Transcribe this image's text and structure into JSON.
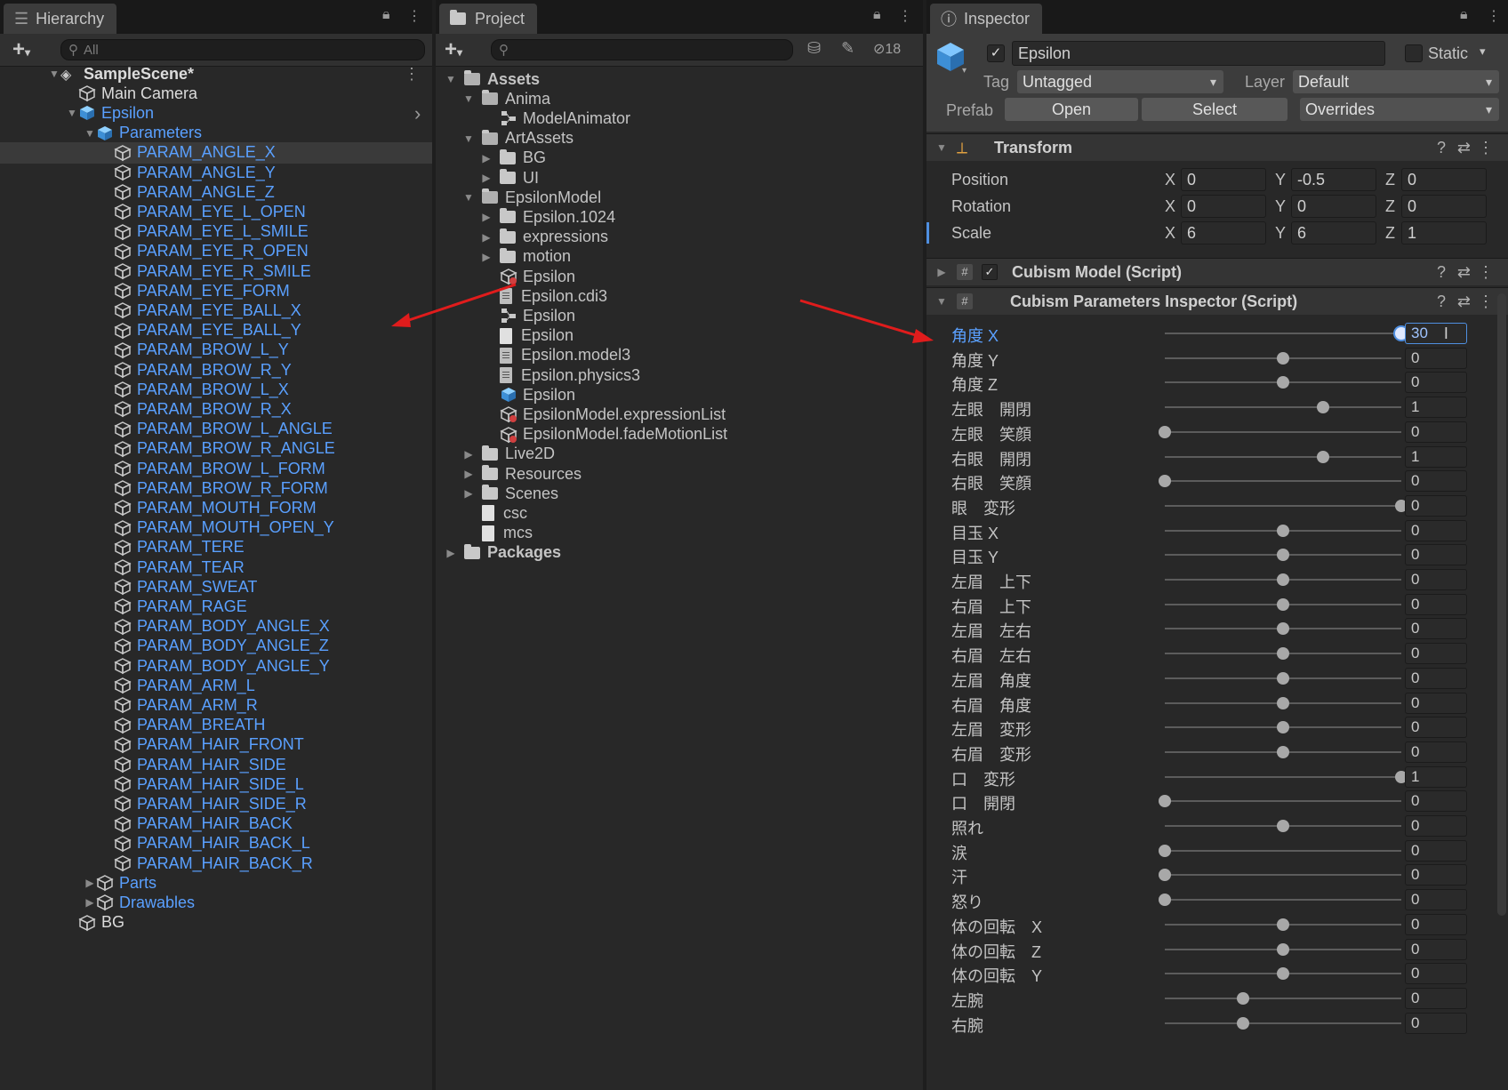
{
  "hierarchy": {
    "tab_label": "Hierarchy",
    "search_placeholder": "All",
    "scene": "SampleScene*",
    "items": [
      {
        "label": "Main Camera",
        "depth": 1,
        "blue": false
      },
      {
        "label": "Epsilon",
        "depth": 1,
        "blue": true,
        "expanded": true
      },
      {
        "label": "Parameters",
        "depth": 2,
        "blue": true,
        "expanded": true
      }
    ],
    "parameters": [
      "PARAM_ANGLE_X",
      "PARAM_ANGLE_Y",
      "PARAM_ANGLE_Z",
      "PARAM_EYE_L_OPEN",
      "PARAM_EYE_L_SMILE",
      "PARAM_EYE_R_OPEN",
      "PARAM_EYE_R_SMILE",
      "PARAM_EYE_FORM",
      "PARAM_EYE_BALL_X",
      "PARAM_EYE_BALL_Y",
      "PARAM_BROW_L_Y",
      "PARAM_BROW_R_Y",
      "PARAM_BROW_L_X",
      "PARAM_BROW_R_X",
      "PARAM_BROW_L_ANGLE",
      "PARAM_BROW_R_ANGLE",
      "PARAM_BROW_L_FORM",
      "PARAM_BROW_R_FORM",
      "PARAM_MOUTH_FORM",
      "PARAM_MOUTH_OPEN_Y",
      "PARAM_TERE",
      "PARAM_TEAR",
      "PARAM_SWEAT",
      "PARAM_RAGE",
      "PARAM_BODY_ANGLE_X",
      "PARAM_BODY_ANGLE_Z",
      "PARAM_BODY_ANGLE_Y",
      "PARAM_ARM_L",
      "PARAM_ARM_R",
      "PARAM_BREATH",
      "PARAM_HAIR_FRONT",
      "PARAM_HAIR_SIDE",
      "PARAM_HAIR_SIDE_L",
      "PARAM_HAIR_SIDE_R",
      "PARAM_HAIR_BACK",
      "PARAM_HAIR_BACK_L",
      "PARAM_HAIR_BACK_R"
    ],
    "after": [
      {
        "label": "Parts",
        "depth": 2,
        "blue": true
      },
      {
        "label": "Drawables",
        "depth": 2,
        "blue": true
      },
      {
        "label": "BG",
        "depth": 1,
        "blue": false
      }
    ]
  },
  "project": {
    "tab_label": "Project",
    "hidden_count": "18",
    "tree": [
      {
        "label": "Assets",
        "depth": 0,
        "icon": "folder-open",
        "arrow": "down",
        "bold": true
      },
      {
        "label": "Anima",
        "depth": 1,
        "icon": "folder-open",
        "arrow": "down"
      },
      {
        "label": "ModelAnimator",
        "depth": 2,
        "icon": "animator",
        "arrow": ""
      },
      {
        "label": "ArtAssets",
        "depth": 1,
        "icon": "folder-open",
        "arrow": "down"
      },
      {
        "label": "BG",
        "depth": 2,
        "icon": "folder",
        "arrow": "right"
      },
      {
        "label": "UI",
        "depth": 2,
        "icon": "folder",
        "arrow": "right"
      },
      {
        "label": "EpsilonModel",
        "depth": 1,
        "icon": "folder-open",
        "arrow": "down"
      },
      {
        "label": "Epsilon.1024",
        "depth": 2,
        "icon": "folder",
        "arrow": "right"
      },
      {
        "label": "expressions",
        "depth": 2,
        "icon": "folder",
        "arrow": "right"
      },
      {
        "label": "motion",
        "depth": 2,
        "icon": "folder",
        "arrow": "right"
      },
      {
        "label": "Epsilon",
        "depth": 2,
        "icon": "asset",
        "arrow": ""
      },
      {
        "label": "Epsilon.cdi3",
        "depth": 2,
        "icon": "doc",
        "arrow": ""
      },
      {
        "label": "Epsilon",
        "depth": 2,
        "icon": "animator",
        "arrow": ""
      },
      {
        "label": "Epsilon",
        "depth": 2,
        "icon": "file",
        "arrow": ""
      },
      {
        "label": "Epsilon.model3",
        "depth": 2,
        "icon": "doc",
        "arrow": ""
      },
      {
        "label": "Epsilon.physics3",
        "depth": 2,
        "icon": "doc",
        "arrow": ""
      },
      {
        "label": "Epsilon",
        "depth": 2,
        "icon": "prefab",
        "arrow": ""
      },
      {
        "label": "EpsilonModel.expressionList",
        "depth": 2,
        "icon": "asset",
        "arrow": ""
      },
      {
        "label": "EpsilonModel.fadeMotionList",
        "depth": 2,
        "icon": "asset",
        "arrow": ""
      },
      {
        "label": "Live2D",
        "depth": 1,
        "icon": "folder",
        "arrow": "right"
      },
      {
        "label": "Resources",
        "depth": 1,
        "icon": "folder",
        "arrow": "right"
      },
      {
        "label": "Scenes",
        "depth": 1,
        "icon": "folder",
        "arrow": "right"
      },
      {
        "label": "csc",
        "depth": 1,
        "icon": "file",
        "arrow": ""
      },
      {
        "label": "mcs",
        "depth": 1,
        "icon": "file",
        "arrow": ""
      },
      {
        "label": "Packages",
        "depth": 0,
        "icon": "folder",
        "arrow": "right",
        "bold": true
      }
    ]
  },
  "inspector": {
    "tab_label": "Inspector",
    "object_name": "Epsilon",
    "static_label": "Static",
    "tag_label": "Tag",
    "tag_value": "Untagged",
    "layer_label": "Layer",
    "layer_value": "Default",
    "prefab_label": "Prefab",
    "open_label": "Open",
    "select_label": "Select",
    "overrides_label": "Overrides",
    "transform": {
      "title": "Transform",
      "position_label": "Position",
      "px": "0",
      "py": "-0.5",
      "pz": "0",
      "rotation_label": "Rotation",
      "rx": "0",
      "ry": "0",
      "rz": "0",
      "scale_label": "Scale",
      "sx": "6",
      "sy": "6",
      "sz": "1"
    },
    "cubism_model": "Cubism Model (Script)",
    "cubism_params": "Cubism Parameters Inspector (Script)",
    "parameters": [
      {
        "label": "角度 X",
        "value": "30",
        "fraction": 1.0,
        "active": true
      },
      {
        "label": "角度 Y",
        "value": "0",
        "fraction": 0.5
      },
      {
        "label": "角度 Z",
        "value": "0",
        "fraction": 0.5
      },
      {
        "label": "左眼　開閉",
        "value": "1",
        "fraction": 0.67
      },
      {
        "label": "左眼　笑顔",
        "value": "0",
        "fraction": 0.0
      },
      {
        "label": "右眼　開閉",
        "value": "1",
        "fraction": 0.67
      },
      {
        "label": "右眼　笑顔",
        "value": "0",
        "fraction": 0.0
      },
      {
        "label": "眼　変形",
        "value": "0",
        "fraction": 1.0
      },
      {
        "label": "目玉 X",
        "value": "0",
        "fraction": 0.5
      },
      {
        "label": "目玉 Y",
        "value": "0",
        "fraction": 0.5
      },
      {
        "label": "左眉　上下",
        "value": "0",
        "fraction": 0.5
      },
      {
        "label": "右眉　上下",
        "value": "0",
        "fraction": 0.5
      },
      {
        "label": "左眉　左右",
        "value": "0",
        "fraction": 0.5
      },
      {
        "label": "右眉　左右",
        "value": "0",
        "fraction": 0.5
      },
      {
        "label": "左眉　角度",
        "value": "0",
        "fraction": 0.5
      },
      {
        "label": "右眉　角度",
        "value": "0",
        "fraction": 0.5
      },
      {
        "label": "左眉　変形",
        "value": "0",
        "fraction": 0.5
      },
      {
        "label": "右眉　変形",
        "value": "0",
        "fraction": 0.5
      },
      {
        "label": "口　変形",
        "value": "1",
        "fraction": 1.0
      },
      {
        "label": "口　開閉",
        "value": "0",
        "fraction": 0.0
      },
      {
        "label": "照れ",
        "value": "0",
        "fraction": 0.5
      },
      {
        "label": "涙",
        "value": "0",
        "fraction": 0.0
      },
      {
        "label": "汗",
        "value": "0",
        "fraction": 0.0
      },
      {
        "label": "怒り",
        "value": "0",
        "fraction": 0.0
      },
      {
        "label": "体の回転　X",
        "value": "0",
        "fraction": 0.5
      },
      {
        "label": "体の回転　Z",
        "value": "0",
        "fraction": 0.5
      },
      {
        "label": "体の回転　Y",
        "value": "0",
        "fraction": 0.5
      },
      {
        "label": "左腕",
        "value": "0",
        "fraction": 0.33
      },
      {
        "label": "右腕",
        "value": "0",
        "fraction": 0.33
      }
    ]
  },
  "colors": {
    "accent_blue": "#5aa0ff",
    "arrow_red": "#e01c1c",
    "panel_bg": "#282828"
  }
}
